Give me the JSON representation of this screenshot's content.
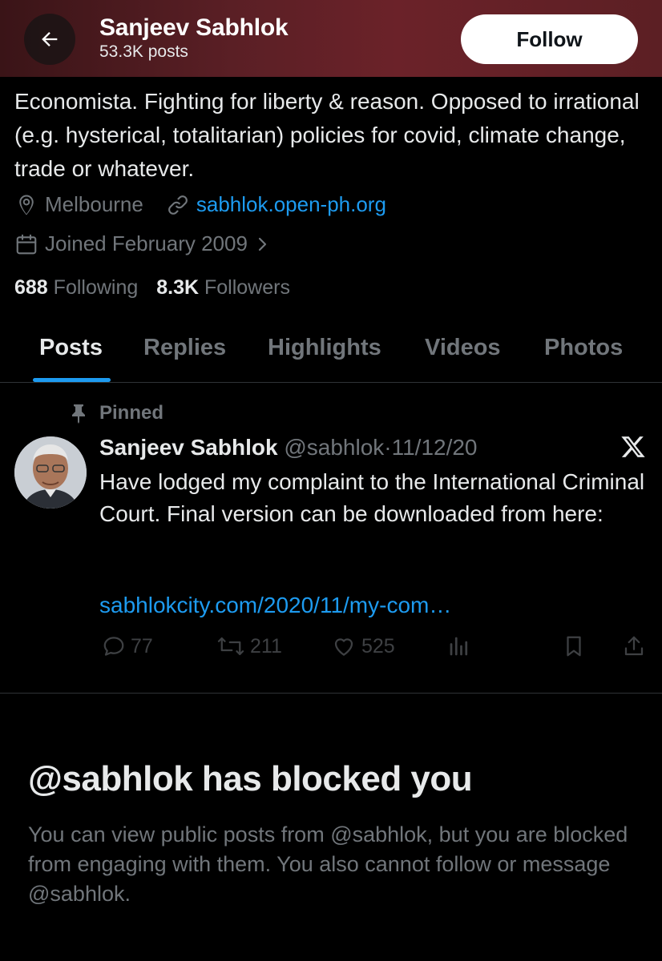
{
  "header": {
    "name": "Sanjeev Sabhlok",
    "posts_count": "53.3K posts",
    "follow_label": "Follow"
  },
  "profile": {
    "bio": "Economista. Fighting for liberty & reason. Opposed to irrational (e.g. hysterical, totalitarian) policies for covid, climate change, trade or whatever.",
    "location": "Melbourne",
    "website": "sabhlok.open-ph.org",
    "joined": "Joined February 2009",
    "following_count": "688",
    "following_label": "Following",
    "followers_count": "8.3K",
    "followers_label": "Followers"
  },
  "tabs": [
    {
      "label": "Posts",
      "active": true
    },
    {
      "label": "Replies",
      "active": false
    },
    {
      "label": "Highlights",
      "active": false
    },
    {
      "label": "Videos",
      "active": false
    },
    {
      "label": "Photos",
      "active": false
    }
  ],
  "pinned_post": {
    "pinned_label": "Pinned",
    "author": "Sanjeev Sabhlok",
    "handle": "@sabhlok",
    "separator": "·",
    "date": "11/12/20",
    "text": "Have lodged my complaint to the International Criminal Court. Final version can be downloaded from here:",
    "link": "sabhlokcity.com/2020/11/my-com…",
    "replies": "77",
    "reposts": "211",
    "likes": "525"
  },
  "blocked": {
    "title": "@sabhlok has blocked you",
    "description": "You can view public posts from @sabhlok, but you are blocked from engaging with them. You also cannot follow or message @sabhlok."
  },
  "colors": {
    "accent": "#1d9bf0",
    "muted": "#71767b",
    "text": "#e7e9ea",
    "background": "#000000",
    "header_tint": "#6b2229"
  },
  "icons": [
    "back-arrow-icon",
    "location-pin-icon",
    "link-icon",
    "calendar-icon",
    "chevron-right-icon",
    "pin-icon",
    "x-logo-icon",
    "reply-icon",
    "repost-icon",
    "like-icon",
    "views-icon",
    "bookmark-icon",
    "share-icon"
  ]
}
